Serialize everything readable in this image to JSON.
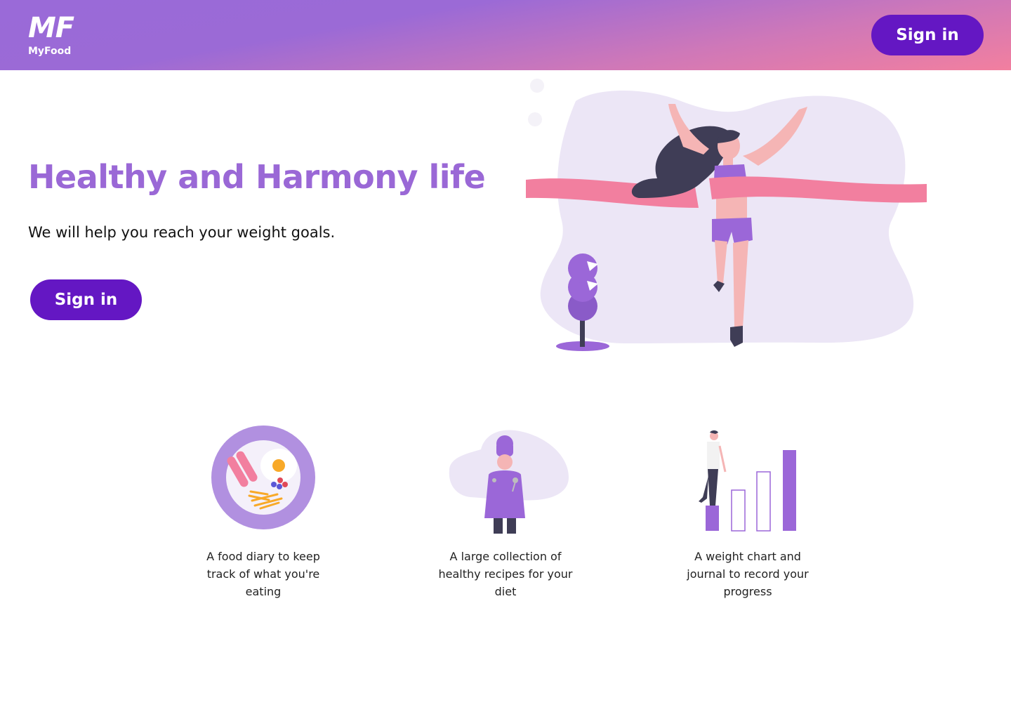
{
  "header": {
    "logo_mark": "MF",
    "logo_name": "MyFood",
    "sign_in_label": "Sign in"
  },
  "hero": {
    "title": "Healthy and Harmony life",
    "subtitle": "We will help you reach your weight goals.",
    "sign_in_label": "Sign in"
  },
  "features": [
    {
      "text": "A food diary to keep track of what you're eating",
      "icon": "food-plate-icon"
    },
    {
      "text": "A large collection of healthy recipes for your diet",
      "icon": "chef-icon"
    },
    {
      "text": "A weight chart and journal to record your progress",
      "icon": "progress-chart-icon"
    }
  ],
  "colors": {
    "accent": "#9a68d6",
    "button": "#6417c3",
    "header_gradient_start": "#9a6ad8",
    "header_gradient_end": "#f27f9f",
    "ribbon": "#f27f9f",
    "blob": "#ece6f6"
  }
}
